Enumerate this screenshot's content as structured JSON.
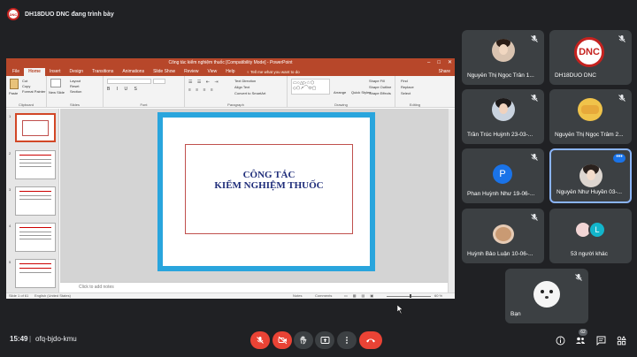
{
  "presenter": {
    "label": "DH18DUO DNC đang trình bày",
    "logo_text": "DNC"
  },
  "powerpoint": {
    "title": "Công tác kiểm nghiệm thuốc [Compatibility Mode] - PowerPoint",
    "controls": [
      "–",
      "□",
      "✕"
    ],
    "tabs": [
      "File",
      "Home",
      "Insert",
      "Design",
      "Transitions",
      "Animations",
      "Slide Show",
      "Review",
      "View",
      "Help"
    ],
    "active_tab": "Home",
    "tell_me": "♀ Tell me what you want to do",
    "share": "Share",
    "ribbon": {
      "clipboard": {
        "label": "Clipboard",
        "paste": "Paste",
        "cut": "Cut",
        "copy": "Copy",
        "format_painter": "Format Painter"
      },
      "slides": {
        "label": "Slides",
        "new_slide": "New Slide",
        "layout": "Layout",
        "reset": "Reset",
        "section": "Section"
      },
      "font": {
        "label": "Font"
      },
      "paragraph": {
        "label": "Paragraph",
        "text_direction": "Text Direction",
        "align_text": "Align Text",
        "smartart": "Convert to SmartArt"
      },
      "drawing": {
        "label": "Drawing",
        "arrange": "Arrange",
        "quick_styles": "Quick Styles",
        "shape_fill": "Shape Fill",
        "shape_outline": "Shape Outline",
        "shape_effects": "Shape Effects"
      },
      "editing": {
        "label": "Editing",
        "find": "Find",
        "replace": "Replace",
        "select": "Select"
      }
    },
    "thumbnail_numbers": [
      "1",
      "2",
      "3",
      "4",
      "5"
    ],
    "slide_title_line1": "CÔNG TÁC",
    "slide_title_line2": "KIỂM NGHIỆM THUỐC",
    "notes_placeholder": "Click to add notes",
    "status_left": "Slide 1 of 61",
    "status_lang": "English (United States)",
    "status_notes": "Notes",
    "status_comments": "Comments",
    "zoom": "60 %"
  },
  "participants": [
    {
      "name": "Nguyễn Thị Ngọc Trân 1...",
      "mic_muted": true
    },
    {
      "name": "DH18DUO DNC",
      "mic_muted": true,
      "avatar_text": "DNC"
    },
    {
      "name": "Trần Trúc Huỳnh 23-03-...",
      "mic_muted": true
    },
    {
      "name": "Nguyễn Thị Ngọc Trâm 2...",
      "mic_muted": true
    },
    {
      "name": "Phan Huỳnh Như 19-06-...",
      "mic_muted": true,
      "avatar_letter": "P",
      "avatar_color": "#1a73e8"
    },
    {
      "name": "Nguyễn Như Huyền 03-...",
      "mic_muted": false,
      "active": true
    },
    {
      "name": "Huỳnh Bảo Luận 10-06-...",
      "mic_muted": true
    },
    {
      "name": "53 người khác",
      "avatar_letter": "L",
      "avatar_color": "#12b5cb"
    },
    {
      "name": "Bạn",
      "mic_muted": true
    }
  ],
  "bottom": {
    "clock": "15:49",
    "separator": "|",
    "meeting_code": "ofq-bjdo-kmu",
    "people_count": "62"
  }
}
